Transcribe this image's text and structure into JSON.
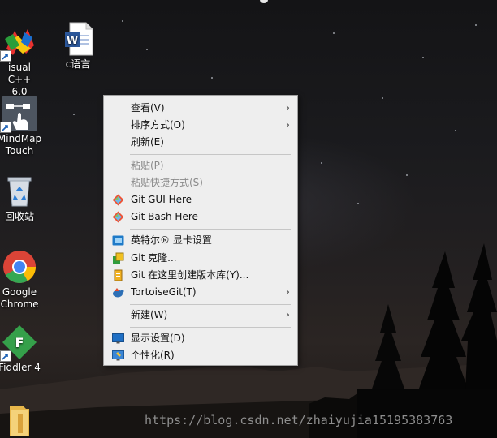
{
  "desktop": {
    "icons": [
      {
        "label": "isual C++\n6.0",
        "icon": "visual-cpp-icon"
      },
      {
        "label": "c语言",
        "icon": "word-document-icon"
      },
      {
        "label": "MindMap\nTouch",
        "icon": "mindmap-icon"
      },
      {
        "label": "回收站",
        "icon": "recycle-bin-icon"
      },
      {
        "label": "Google\nChrome",
        "icon": "chrome-icon"
      },
      {
        "label": "Fiddler 4",
        "icon": "fiddler-icon"
      },
      {
        "label": "",
        "icon": "folder-icon"
      }
    ]
  },
  "context_menu": {
    "items": [
      {
        "label": "查看(V)",
        "submenu": true,
        "disabled": false,
        "icon": ""
      },
      {
        "label": "排序方式(O)",
        "submenu": true,
        "disabled": false,
        "icon": ""
      },
      {
        "label": "刷新(E)",
        "submenu": false,
        "disabled": false,
        "icon": ""
      },
      {
        "label": "粘贴(P)",
        "submenu": false,
        "disabled": true,
        "icon": ""
      },
      {
        "label": "粘贴快捷方式(S)",
        "submenu": false,
        "disabled": true,
        "icon": ""
      },
      {
        "label": "Git GUI Here",
        "submenu": false,
        "disabled": false,
        "icon": "git-icon"
      },
      {
        "label": "Git Bash Here",
        "submenu": false,
        "disabled": false,
        "icon": "git-icon"
      },
      {
        "label": "英特尔® 显卡设置",
        "submenu": false,
        "disabled": false,
        "icon": "intel-graphics-icon"
      },
      {
        "label": "Git 克隆...",
        "submenu": false,
        "disabled": false,
        "icon": "tortoisegit-clone-icon"
      },
      {
        "label": "Git 在这里创建版本库(Y)...",
        "submenu": false,
        "disabled": false,
        "icon": "tortoisegit-create-repo-icon"
      },
      {
        "label": "TortoiseGit(T)",
        "submenu": true,
        "disabled": false,
        "icon": "tortoisegit-icon"
      },
      {
        "label": "新建(W)",
        "submenu": true,
        "disabled": false,
        "icon": ""
      },
      {
        "label": "显示设置(D)",
        "submenu": false,
        "disabled": false,
        "icon": "display-settings-icon"
      },
      {
        "label": "个性化(R)",
        "submenu": false,
        "disabled": false,
        "icon": "personalize-icon"
      }
    ],
    "submenu_glyph": "›"
  },
  "watermark": "https://blog.csdn.net/zhaiyujia15195383763",
  "colors": {
    "menu_bg": "#eeeeee",
    "menu_border": "#a0a0a0",
    "disabled_text": "#8a8a8a",
    "git_orange": "#f05133",
    "word_blue": "#2b579a",
    "chrome_green": "#34a853",
    "fiddler_green": "#35a04a"
  }
}
